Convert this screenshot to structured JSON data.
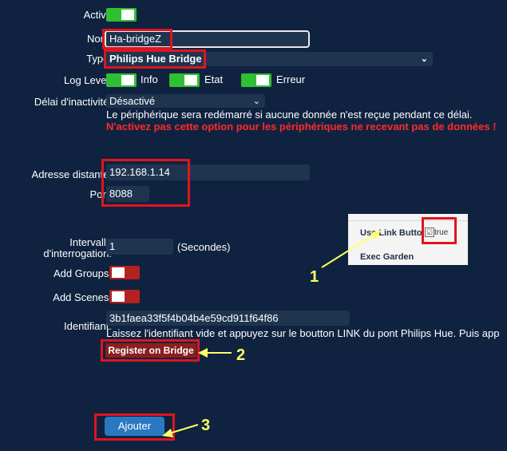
{
  "form": {
    "active_label": "Activé",
    "name_label": "Nom:",
    "name_value": "Ha-bridgeZ",
    "type_label": "Type:",
    "type_value": "Philips Hue Bridge",
    "loglevel_label": "Log Level:",
    "log_info": "Info",
    "log_etat": "Etat",
    "log_erreur": "Erreur",
    "inactivity_label": "Délai d'inactivité:",
    "inactivity_value": "Désactivé",
    "inactivity_help": "Le périphérique sera redémarré si aucune donnée n'est reçue pendant ce délai.",
    "inactivity_warning": "N'activez pas cette option pour les périphériques ne recevant pas de données !",
    "address_label": "Adresse distante:",
    "address_value": "192.168.1.14",
    "port_label": "Port:",
    "port_value": "8088",
    "interval_label_1": "Intervalle",
    "interval_label_2": "d'interrogation:",
    "interval_value": "1",
    "interval_unit": "(Secondes)",
    "add_groups_label": "Add Groups:",
    "add_scenes_label": "Add Scenes:",
    "identifiant_label": "Identifiant:",
    "identifiant_value": "3b1faea33f5f4b04b4e59cd911f64f86",
    "identifiant_help": "Laissez l'identifiant vide et appuyez sur le boutton LINK du pont Philips Hue. Puis app",
    "register_button": "Register on Bridge",
    "add_button": "Ajouter"
  },
  "inset": {
    "use_link": "Use Link Butto",
    "checkbox_text": "true",
    "exec_garden": "Exec Garden"
  },
  "annotations": {
    "one": "1",
    "two": "2",
    "three": "3"
  },
  "colors": {
    "background": "#0f2340",
    "toggle_on": "#2fbf32",
    "toggle_off": "#b32121",
    "highlight": "#e0141e",
    "arrow": "#ffff66",
    "warning": "#ff2a2a"
  }
}
